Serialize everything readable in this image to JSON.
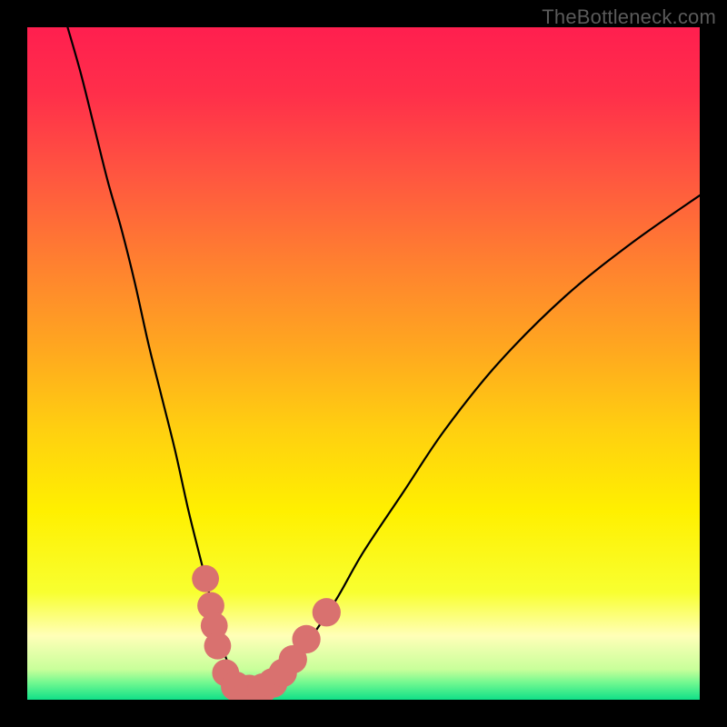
{
  "watermark": "TheBottleneck.com",
  "chart_data": {
    "type": "line",
    "title": "",
    "xlabel": "",
    "ylabel": "",
    "xlim": [
      0,
      100
    ],
    "ylim": [
      0,
      100
    ],
    "grid": false,
    "legend": false,
    "series": [
      {
        "name": "curve",
        "color": "#000000",
        "x": [
          6,
          8,
          10,
          12,
          14,
          16,
          18,
          20,
          22,
          24,
          26,
          27,
          28,
          29,
          30,
          31,
          32,
          33,
          34,
          36,
          38,
          42,
          46,
          50,
          56,
          62,
          70,
          80,
          90,
          100
        ],
        "y": [
          100,
          93,
          85,
          77,
          70,
          62,
          53,
          45,
          37,
          28,
          20,
          16,
          12,
          8,
          5,
          3,
          2,
          1.5,
          1.5,
          2,
          4,
          9,
          15,
          22,
          31,
          40,
          50,
          60,
          68,
          75
        ]
      }
    ],
    "markers": [
      {
        "x": 26.5,
        "y": 18,
        "r": 1.2,
        "color": "#d9716f"
      },
      {
        "x": 27.3,
        "y": 14,
        "r": 1.2,
        "color": "#d9716f"
      },
      {
        "x": 27.8,
        "y": 11,
        "r": 1.2,
        "color": "#d9716f"
      },
      {
        "x": 28.3,
        "y": 8,
        "r": 1.2,
        "color": "#d9716f"
      },
      {
        "x": 29.5,
        "y": 4,
        "r": 1.2,
        "color": "#d9716f"
      },
      {
        "x": 31.0,
        "y": 2,
        "r": 1.4,
        "color": "#d9716f"
      },
      {
        "x": 33.0,
        "y": 1.5,
        "r": 1.4,
        "color": "#d9716f"
      },
      {
        "x": 35.0,
        "y": 1.7,
        "r": 1.4,
        "color": "#d9716f"
      },
      {
        "x": 36.5,
        "y": 2.5,
        "r": 1.4,
        "color": "#d9716f"
      },
      {
        "x": 38.0,
        "y": 4,
        "r": 1.3,
        "color": "#d9716f"
      },
      {
        "x": 39.5,
        "y": 6,
        "r": 1.3,
        "color": "#d9716f"
      },
      {
        "x": 41.5,
        "y": 9,
        "r": 1.3,
        "color": "#d9716f"
      },
      {
        "x": 44.5,
        "y": 13,
        "r": 1.3,
        "color": "#d9716f"
      }
    ],
    "background_gradient": {
      "stops": [
        {
          "offset": 0.0,
          "color": "#ff1f4f"
        },
        {
          "offset": 0.1,
          "color": "#ff2f4a"
        },
        {
          "offset": 0.22,
          "color": "#ff5640"
        },
        {
          "offset": 0.35,
          "color": "#ff8030"
        },
        {
          "offset": 0.48,
          "color": "#ffa81f"
        },
        {
          "offset": 0.6,
          "color": "#ffd010"
        },
        {
          "offset": 0.72,
          "color": "#fff000"
        },
        {
          "offset": 0.84,
          "color": "#f8ff30"
        },
        {
          "offset": 0.905,
          "color": "#ffffb8"
        },
        {
          "offset": 0.955,
          "color": "#c8ff9a"
        },
        {
          "offset": 0.975,
          "color": "#70f890"
        },
        {
          "offset": 1.0,
          "color": "#10e088"
        }
      ]
    }
  }
}
